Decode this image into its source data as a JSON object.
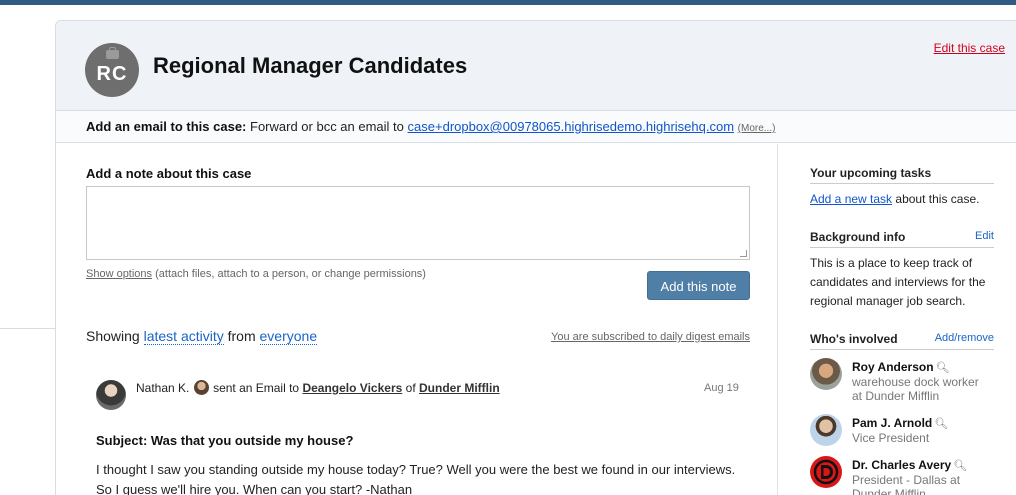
{
  "case": {
    "initials": "RC",
    "title": "Regional Manager Candidates",
    "edit_label": "Edit this case"
  },
  "email_bar": {
    "label": "Add an email to this case:",
    "text": "Forward or bcc an email to",
    "address": "case+dropbox@00978065.highrisedemo.highrisehq.com",
    "more": "(More...)"
  },
  "note": {
    "label": "Add a note about this case",
    "value": "",
    "show_options": "Show options",
    "options_hint": "(attach files, attach to a person, or change permissions)",
    "submit": "Add this note"
  },
  "activity_filter": {
    "prefix": "Showing",
    "kind": "latest activity",
    "middle": "from",
    "who": "everyone",
    "subscribed": "You are subscribed to daily digest emails"
  },
  "activity": {
    "author": "Nathan K.",
    "verb": "sent an Email to",
    "recipient": "Deangelo Vickers",
    "of": "of",
    "company": "Dunder Mifflin",
    "date": "Aug 19",
    "subject": "Subject: Was that you outside my house?",
    "body": "I thought I saw you standing outside my house today? True? Well you were the best we found in our interviews. So I guess we'll hire you. When can you start? -Nathan"
  },
  "sidebar": {
    "tasks_heading": "Your upcoming tasks",
    "add_task_link": "Add a new task",
    "add_task_suffix": "about this case.",
    "background_heading": "Background info",
    "background_edit": "Edit",
    "background_text": "This is a place to keep track of candidates and interviews for the regional manager job search.",
    "involved_heading": "Who's involved",
    "involved_action": "Add/remove",
    "people": [
      {
        "name": "Roy Anderson",
        "role_line1": "warehouse dock worker",
        "role_line2": "at Dunder Mifflin"
      },
      {
        "name": "Pam J. Arnold",
        "role_line1": "Vice President",
        "role_line2": ""
      },
      {
        "name": "Dr. Charles Avery",
        "role_line1": "President - Dallas at",
        "role_line2": "Dunder Mifflin"
      }
    ]
  },
  "colors": {
    "top_bar": "#2f5b85",
    "header_bg": "#eff3f8",
    "edit_link": "#d0021b",
    "primary_button": "#4f7fa6",
    "link": "#1155cc"
  }
}
